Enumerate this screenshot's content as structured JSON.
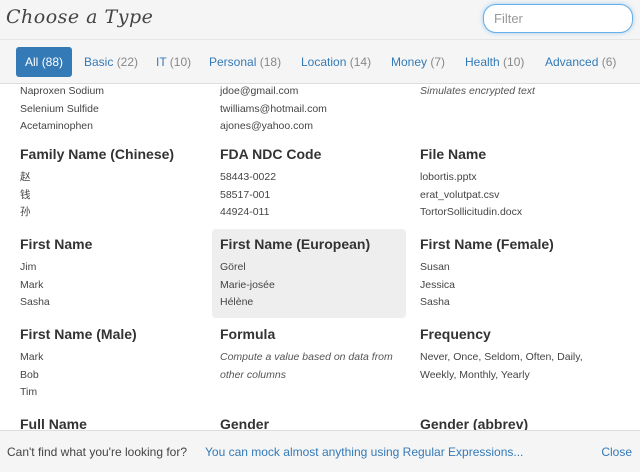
{
  "header": {
    "title": "Choose a Type",
    "filter_placeholder": "Filter"
  },
  "tabs": [
    {
      "label": "All",
      "count": "(88)"
    },
    {
      "label": "Basic",
      "count": "(22)"
    },
    {
      "label": "IT",
      "count": "(10)"
    },
    {
      "label": "Personal",
      "count": "(18)"
    },
    {
      "label": "Location",
      "count": "(14)"
    },
    {
      "label": "Money",
      "count": "(7)"
    },
    {
      "label": "Health",
      "count": "(10)"
    },
    {
      "label": "Advanced",
      "count": "(6)"
    }
  ],
  "types": [
    {
      "name": "",
      "examples": [
        "Naproxen Sodium",
        "Selenium Sulfide",
        "Acetaminophen"
      ]
    },
    {
      "name": "",
      "examples": [
        "jdoe@gmail.com",
        "twilliams@hotmail.com",
        "ajones@yahoo.com"
      ]
    },
    {
      "name": "",
      "description": "Simulates encrypted text"
    },
    {
      "name": "Family Name (Chinese)",
      "examples": [
        "赵",
        "钱",
        "孙"
      ]
    },
    {
      "name": "FDA NDC Code",
      "examples": [
        "58443-0022",
        "58517-001",
        "44924-011"
      ]
    },
    {
      "name": "File Name",
      "examples": [
        "lobortis.pptx",
        "erat_volutpat.csv",
        "TortorSollicitudin.docx"
      ]
    },
    {
      "name": "First Name",
      "examples": [
        "Jim",
        "Mark",
        "Sasha"
      ]
    },
    {
      "name": "First Name (European)",
      "examples": [
        "Görel",
        "Marie-josée",
        "Hélène"
      ],
      "highlighted": true
    },
    {
      "name": "First Name (Female)",
      "examples": [
        "Susan",
        "Jessica",
        "Sasha"
      ]
    },
    {
      "name": "First Name (Male)",
      "examples": [
        "Mark",
        "Bob",
        "Tim"
      ]
    },
    {
      "name": "Formula",
      "description": "Compute a value based on data from other columns"
    },
    {
      "name": "Frequency",
      "examples": [
        "Never, Once, Seldom, Often, Daily,",
        "Weekly, Monthly, Yearly"
      ]
    },
    {
      "name": "Full Name",
      "examples": []
    },
    {
      "name": "Gender",
      "examples": []
    },
    {
      "name": "Gender (abbrev)",
      "examples": []
    }
  ],
  "footer": {
    "question": "Can't find what you're looking for?",
    "link": "You can mock almost anything using Regular Expressions...",
    "close": "Close"
  }
}
